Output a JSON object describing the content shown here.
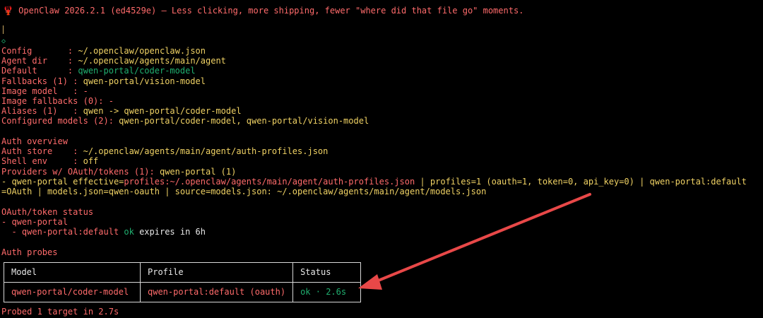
{
  "banner": {
    "icon": "lobster-icon",
    "text": "OpenClaw 2026.2.1 (ed4529e) — Less clicking, more shipping, fewer \"where did that file go\" moments."
  },
  "config": {
    "config_label": "Config       : ",
    "config_value": "~/.openclaw/openclaw.json",
    "agent_label": "Agent dir    : ",
    "agent_value": "~/.openclaw/agents/main/agent",
    "default_label": "Default      : ",
    "default_value": "qwen-portal/coder-model",
    "fallbacks_label": "Fallbacks (1) : ",
    "fallbacks_value": "qwen-portal/vision-model",
    "image_model_label": "Image model   : ",
    "image_model_value": "-",
    "image_fallbacks_label": "Image fallbacks (0): ",
    "image_fallbacks_value": "-",
    "aliases_label": "Aliases (1)   : ",
    "aliases_value": "qwen -> qwen-portal/coder-model",
    "configured_label": "Configured models (2): ",
    "configured_value": "qwen-portal/coder-model, qwen-portal/vision-model"
  },
  "auth": {
    "title": "Auth overview",
    "store_label": "Auth store    : ",
    "store_value": "~/.openclaw/agents/main/agent/auth-profiles.json",
    "shell_label": "Shell env     : ",
    "shell_value": "off",
    "providers_label": "Providers w/ OAuth/tokens (1): ",
    "providers_value": "qwen-portal (1)",
    "effective_prefix": "- qwen-portal effective=",
    "effective_profiles": "profiles:~/.openclaw/agents/main/agent/auth-profiles.json",
    "effective_sep1": " | ",
    "effective_rest1": "profiles=1 (oauth=1, token=0, api_key=0) | qwen-portal:default",
    "effective_line2": "=OAuth | models.json=qwen-oauth | source=models.json: ~/.openclaw/agents/main/agent/models.json"
  },
  "oauth_status": {
    "title": "OAuth/token status",
    "provider": "- qwen-portal",
    "profile_prefix": "  - qwen-portal:default ",
    "profile_status": "ok",
    "profile_expiry": " expires in 6h"
  },
  "probes": {
    "title": "Auth probes",
    "headers": [
      "Model",
      "Profile",
      "Status"
    ],
    "row": {
      "model": "qwen-portal/coder-model",
      "profile": "qwen-portal:default (oauth)",
      "status": "ok · 2.6s"
    },
    "footer": "Probed 1 target in 2.7s"
  },
  "colors": {
    "background": "#000000",
    "pink": "#ff6b6b",
    "yellow": "#f0d264",
    "green": "#20b070",
    "arrow": "#e84848"
  }
}
